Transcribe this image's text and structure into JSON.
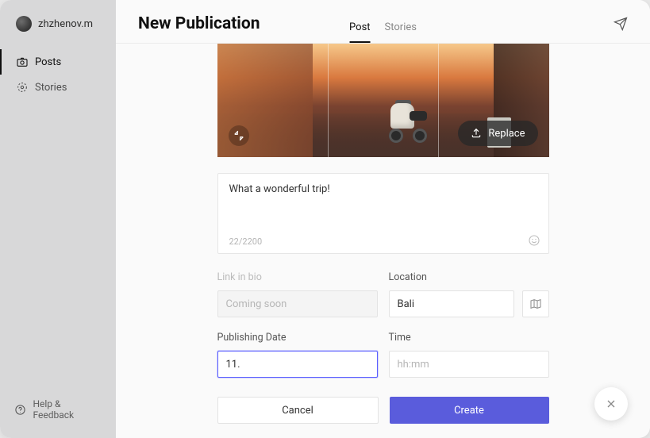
{
  "user": {
    "name": "zhzhenov.m"
  },
  "nav": {
    "posts": "Posts",
    "stories": "Stories",
    "help": "Help & Feedback"
  },
  "header": {
    "title": "New Publication",
    "tabs": {
      "post": "Post",
      "stories": "Stories"
    }
  },
  "image": {
    "replace": "Replace"
  },
  "caption": {
    "text": "What a wonderful trip!",
    "counter": "22/2200"
  },
  "fields": {
    "link_label": "Link in bio",
    "link_placeholder": "Coming soon",
    "location_label": "Location",
    "location_value": "Bali",
    "date_label": "Publishing Date",
    "date_value": "11.",
    "time_label": "Time",
    "time_placeholder": "hh:mm"
  },
  "buttons": {
    "cancel": "Cancel",
    "create": "Create"
  }
}
